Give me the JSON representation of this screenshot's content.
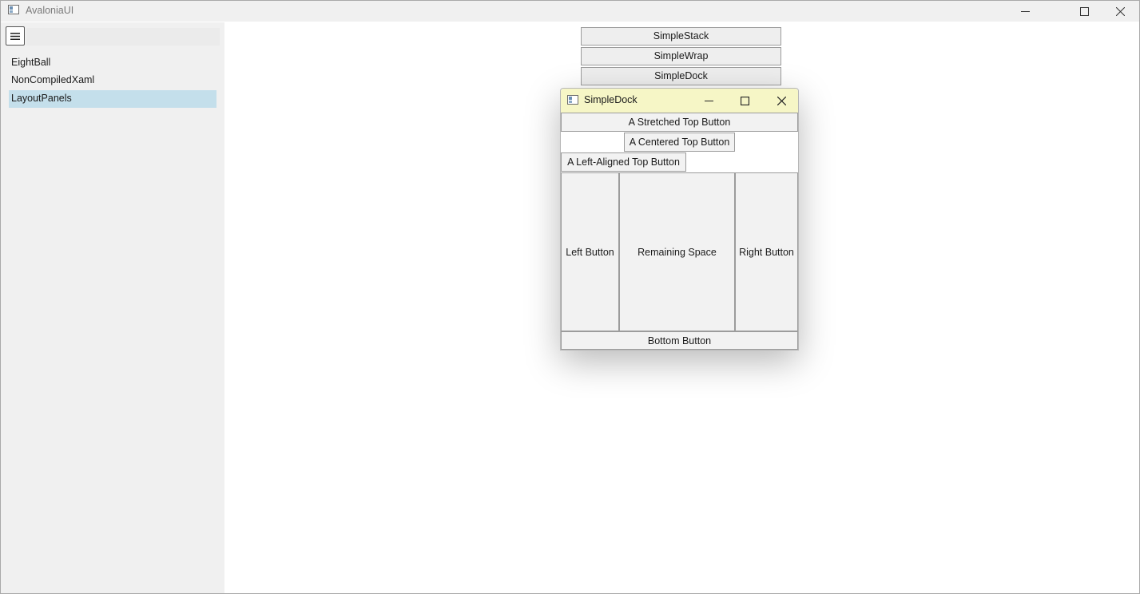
{
  "window": {
    "title": "AvaloniaUI",
    "controls": [
      "minimize-icon",
      "maximize-icon",
      "close-icon"
    ]
  },
  "sidebar": {
    "menu_icon": "hamburger-icon",
    "search_value": "",
    "items": [
      {
        "label": "EightBall",
        "selected": false
      },
      {
        "label": "NonCompiledXaml",
        "selected": false
      },
      {
        "label": "LayoutPanels",
        "selected": true
      }
    ]
  },
  "main": {
    "layout_buttons": [
      {
        "label": "SimpleStack"
      },
      {
        "label": "SimpleWrap"
      },
      {
        "label": "SimpleDock"
      }
    ]
  },
  "dock_window": {
    "title": "SimpleDock",
    "stretched_top": "A Stretched Top Button",
    "centered_top": "A Centered Top Button",
    "left_aligned_top": "A Left-Aligned Top Button",
    "left": "Left Button",
    "remaining": "Remaining Space",
    "right": "Right Button",
    "bottom": "Bottom Button"
  },
  "colors": {
    "selected_item": "#c4dfeb",
    "dock_titlebar": "#f6f6c6",
    "sidebar_bg": "#f0f0f0",
    "button_bg": "#eeeeee"
  }
}
